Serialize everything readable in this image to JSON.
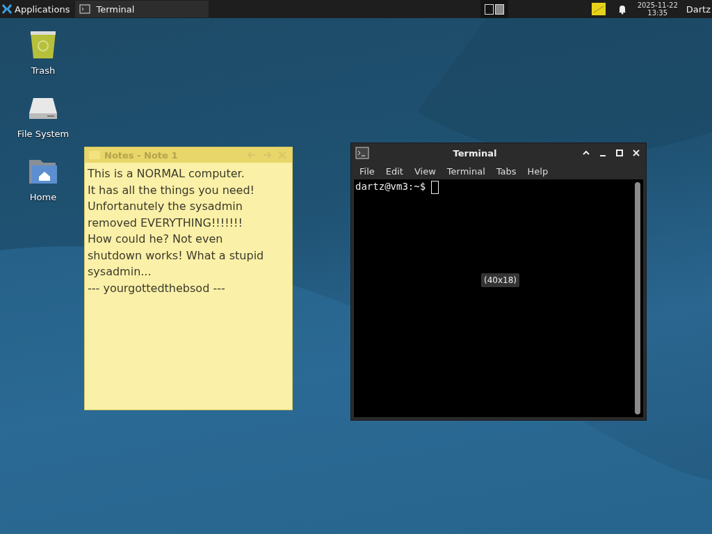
{
  "panel": {
    "menu_label": "Applications",
    "tasks": [
      {
        "label": "Terminal",
        "selected": true
      }
    ],
    "workspaces": [
      {
        "selected": false
      },
      {
        "selected": true
      }
    ],
    "clock": {
      "date": "2025-11-22",
      "time": "13:35"
    },
    "user": "Dartz"
  },
  "desktop_icons": [
    {
      "kind": "trash",
      "label": "Trash"
    },
    {
      "kind": "drive",
      "label": "File System"
    },
    {
      "kind": "home",
      "label": "Home"
    }
  ],
  "notes_window": {
    "title": "Notes - Note 1",
    "lines": [
      "This is a NORMAL computer.",
      "It has all the things you need!",
      "Unfortanutely the sysadmin",
      "removed EVERYTHING!!!!!!!",
      "How could he? Not even",
      "shutdown works! What a stupid",
      "sysadmin...",
      "--- yourgottedthebsod ---"
    ]
  },
  "terminal_window": {
    "title": "Terminal",
    "menu": [
      "File",
      "Edit",
      "View",
      "Terminal",
      "Tabs",
      "Help"
    ],
    "prompt": "dartz@vm3:~$",
    "size_tooltip": "(40x18)"
  }
}
